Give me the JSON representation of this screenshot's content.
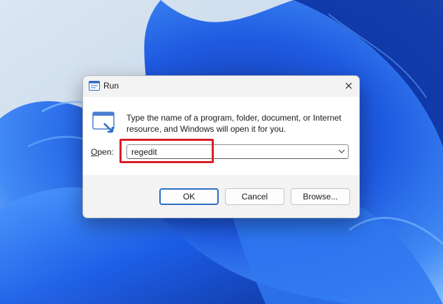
{
  "window": {
    "title": "Run",
    "close_label": "Close"
  },
  "content": {
    "description": "Type the name of a program, folder, document, or Internet resource, and Windows will open it for you.",
    "open_label_mnemonic": "O",
    "open_label_rest": "pen:",
    "open_value": "regedit"
  },
  "buttons": {
    "ok": "OK",
    "cancel": "Cancel",
    "browse": "Browse..."
  },
  "annotation": {
    "color": "#d91e26"
  },
  "colors": {
    "accent": "#2b6cc4",
    "wallpaper_base": "#c9d9ea",
    "wallpaper_bloom": "#1450d8"
  },
  "icons": [
    "run-app-icon",
    "close-icon",
    "run-dialog-icon",
    "chevron-down-icon"
  ]
}
